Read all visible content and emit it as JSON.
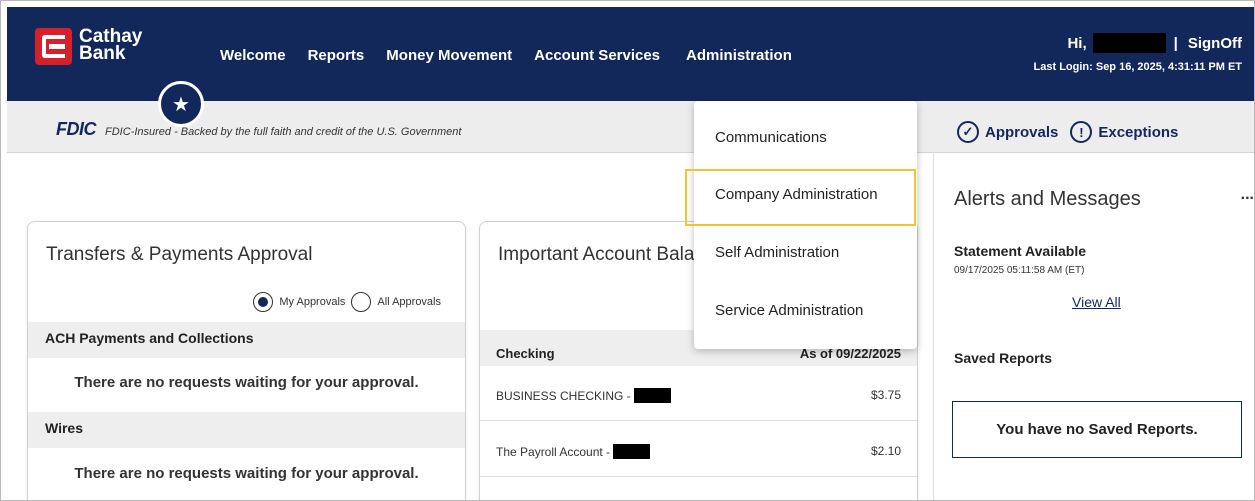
{
  "brand": {
    "line1": "Cathay",
    "line2": "Bank"
  },
  "nav": {
    "items": [
      "Welcome",
      "Reports",
      "Money Movement",
      "Account Services",
      "Administration"
    ]
  },
  "user": {
    "greeting": "Hi,",
    "separator": "|",
    "signoff": "SignOff",
    "last_login": "Last Login: Sep 16, 2025, 4:31:11 PM ET"
  },
  "fdic": {
    "logo": "FDIC",
    "text": "FDIC-Insured - Backed by the full faith and credit of the U.S. Government"
  },
  "quick_links": {
    "approvals": "Approvals",
    "exceptions": "Exceptions"
  },
  "admin_menu": {
    "items": [
      "Communications",
      "Company Administration",
      "Self Administration",
      "Service Administration"
    ],
    "highlighted": "Company Administration"
  },
  "transfers_card": {
    "title": "Transfers & Payments Approval",
    "radio_my": "My Approvals",
    "radio_all": "All Approvals",
    "sections": [
      {
        "header": "ACH Payments and Collections",
        "message": "There are no requests waiting for your approval."
      },
      {
        "header": "Wires",
        "message": "There are no requests waiting for your approval."
      }
    ]
  },
  "balances_card": {
    "title": "Important Account Balances",
    "header_left": "Checking",
    "header_right": "As of 09/22/2025",
    "rows": [
      {
        "name": "BUSINESS CHECKING -",
        "amount": "$3.75"
      },
      {
        "name": "The Payroll Account -",
        "amount": "$2.10"
      }
    ]
  },
  "sidebar": {
    "title": "Alerts and Messages",
    "more": "...",
    "statement_title": "Statement Available",
    "statement_date": "09/17/2025 05:11:58 AM (ET)",
    "view_all": "View All",
    "saved_reports_title": "Saved Reports",
    "saved_reports_empty": "You have no Saved Reports."
  },
  "colors": {
    "navy": "#13285a",
    "brand_red": "#d6202a",
    "highlight": "#f4c430"
  }
}
